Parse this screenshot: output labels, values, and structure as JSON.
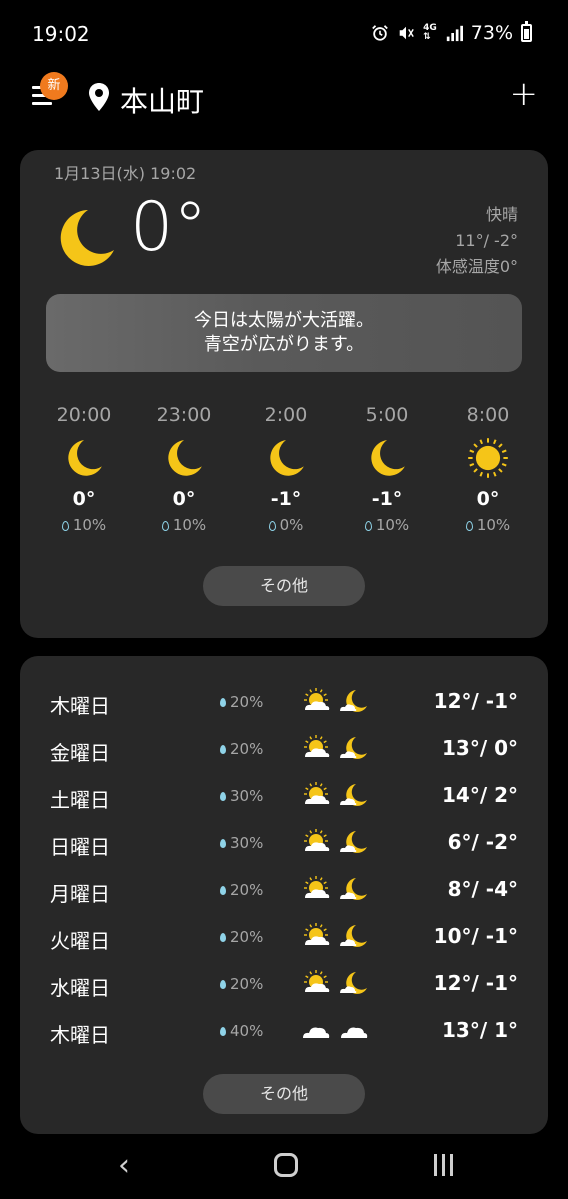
{
  "status_bar": {
    "time": "19:02",
    "battery": "73%",
    "network": "4G"
  },
  "header": {
    "badge": "新",
    "location": "本山町",
    "add": "+"
  },
  "current": {
    "datetime": "1月13日(水) 19:02",
    "temp": "0°",
    "condition": "快晴",
    "hilo": "11°/ -2°",
    "feels": "体感温度0°",
    "message_line1": "今日は太陽が大活躍。",
    "message_line2": "青空が広がります。",
    "more_label": "その他"
  },
  "hourly": [
    {
      "time": "20:00",
      "icon": "moon-icon",
      "temp": "0°",
      "precip": "10%"
    },
    {
      "time": "23:00",
      "icon": "moon-icon",
      "temp": "0°",
      "precip": "10%"
    },
    {
      "time": "2:00",
      "icon": "moon-icon",
      "temp": "-1°",
      "precip": "0%"
    },
    {
      "time": "5:00",
      "icon": "moon-icon",
      "temp": "-1°",
      "precip": "10%"
    },
    {
      "time": "8:00",
      "icon": "sun-icon",
      "temp": "0°",
      "precip": "10%"
    }
  ],
  "daily": [
    {
      "day": "木曜日",
      "precip": "20%",
      "day_icon": "sun-cloud-icon",
      "night_icon": "moon-cloud-icon",
      "temps": "12°/ -1°"
    },
    {
      "day": "金曜日",
      "precip": "20%",
      "day_icon": "sun-cloud-icon",
      "night_icon": "moon-cloud-icon",
      "temps": "13°/ 0°"
    },
    {
      "day": "土曜日",
      "precip": "30%",
      "day_icon": "sun-cloud-icon",
      "night_icon": "moon-cloud-icon",
      "temps": "14°/ 2°"
    },
    {
      "day": "日曜日",
      "precip": "30%",
      "day_icon": "sun-cloud-icon",
      "night_icon": "moon-cloud-icon",
      "temps": "6°/ -2°"
    },
    {
      "day": "月曜日",
      "precip": "20%",
      "day_icon": "sun-cloud-icon",
      "night_icon": "moon-cloud-icon",
      "temps": "8°/ -4°"
    },
    {
      "day": "火曜日",
      "precip": "20%",
      "day_icon": "sun-cloud-icon",
      "night_icon": "moon-cloud-icon",
      "temps": "10°/ -1°"
    },
    {
      "day": "水曜日",
      "precip": "20%",
      "day_icon": "sun-cloud-icon",
      "night_icon": "moon-cloud-icon",
      "temps": "12°/ -1°"
    },
    {
      "day": "木曜日",
      "precip": "40%",
      "day_icon": "cloud-icon",
      "night_icon": "cloud-icon",
      "temps": "13°/ 1°"
    }
  ],
  "daily_more_label": "その他",
  "colors": {
    "background": "#000000",
    "card": "#282828",
    "accent_badge": "#f07a1e",
    "moon": "#f5c518",
    "precip_drop": "#8fd3e8"
  }
}
